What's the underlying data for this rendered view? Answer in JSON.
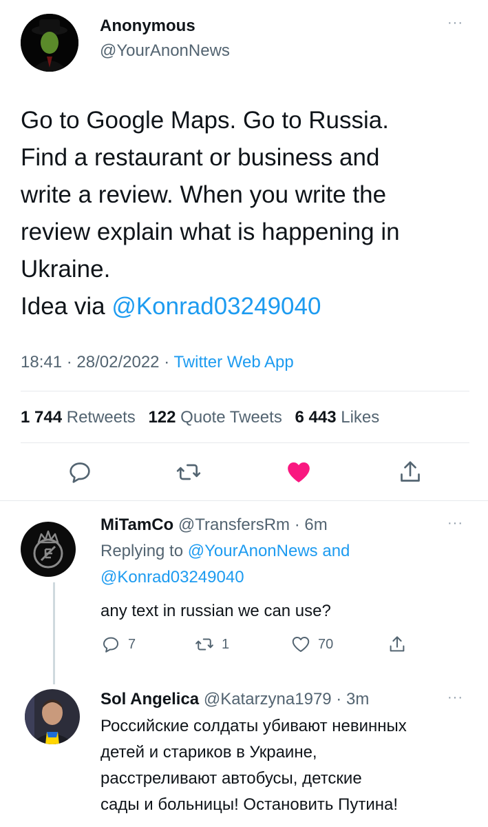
{
  "main_tweet": {
    "author_name": "Anonymous",
    "author_handle": "@YourAnonNews",
    "text_lines": [
      "Go to Google Maps.  Go to Russia.",
      "Find a restaurant or business and",
      "write a review.   When you write the",
      "review explain what is happening in",
      "Ukraine."
    ],
    "idea_prefix": "Idea via ",
    "idea_mention": "@Konrad03249040",
    "time": "18:41",
    "date": "28/02/2022",
    "source": "Twitter Web App",
    "separator": "·",
    "retweets_count": "1 744",
    "retweets_label": "Retweets",
    "quotes_count": "122",
    "quotes_label": "Quote Tweets",
    "likes_count": "6 443",
    "likes_label": "Likes"
  },
  "more_glyph": "···",
  "replies": [
    {
      "name": "MiTamCo",
      "handle": "@TransfersRm",
      "time": "6m",
      "replying_prefix": "Replying to ",
      "replying_to_1": "@YourAnonNews",
      "replying_and": " and",
      "replying_to_2": "@Konrad03249040",
      "text": "any text in russian we can use?",
      "reply_count": "7",
      "retweet_count": "1",
      "like_count": "70"
    },
    {
      "name": "Sol Angelica",
      "handle": "@Katarzyna1979",
      "time": "3m",
      "text_lines": [
        "Российские солдаты убивают невинных",
        "детей и стариков в Украине,",
        "расстреливают автобусы, детские",
        "сады и больницы!  Остановить Путина!"
      ]
    }
  ],
  "colors": {
    "accent": "#1d9bf0",
    "like_active": "#f91880",
    "secondary_text": "#536471"
  }
}
